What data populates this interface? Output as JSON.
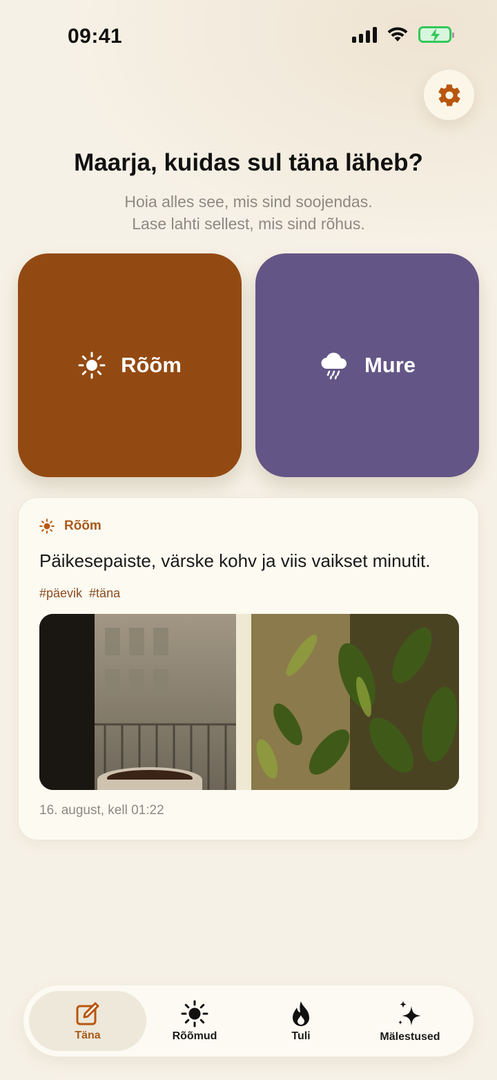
{
  "status_bar": {
    "time": "09:41"
  },
  "settings": {
    "icon": "gear-icon"
  },
  "header": {
    "greeting": "Maarja, kuidas sul täna läheb?",
    "subtitle_line1": "Hoia alles see, mis sind soojendas.",
    "subtitle_line2": "Lase lahti sellest, mis sind rõhus."
  },
  "moods": [
    {
      "label": "Rõõm",
      "icon": "sun-icon",
      "color": "#934a12"
    },
    {
      "label": "Mure",
      "icon": "rain-cloud-icon",
      "color": "#635686"
    }
  ],
  "entry": {
    "mood_label": "Rõõm",
    "text": "Päikesepaiste, värske kohv ja viis vaikset minutit.",
    "tags": [
      "#päevik",
      "#täna"
    ],
    "date": "16. august, kell 01:22"
  },
  "tabs": [
    {
      "label": "Täna",
      "icon": "edit-icon",
      "active": true
    },
    {
      "label": "Rõõmud",
      "icon": "sun-icon",
      "active": false
    },
    {
      "label": "Tuli",
      "icon": "flame-icon",
      "active": false
    },
    {
      "label": "Mälestused",
      "icon": "sparkles-icon",
      "active": false
    }
  ],
  "colors": {
    "accent": "#a9591a",
    "background": "#f6f1e6"
  }
}
